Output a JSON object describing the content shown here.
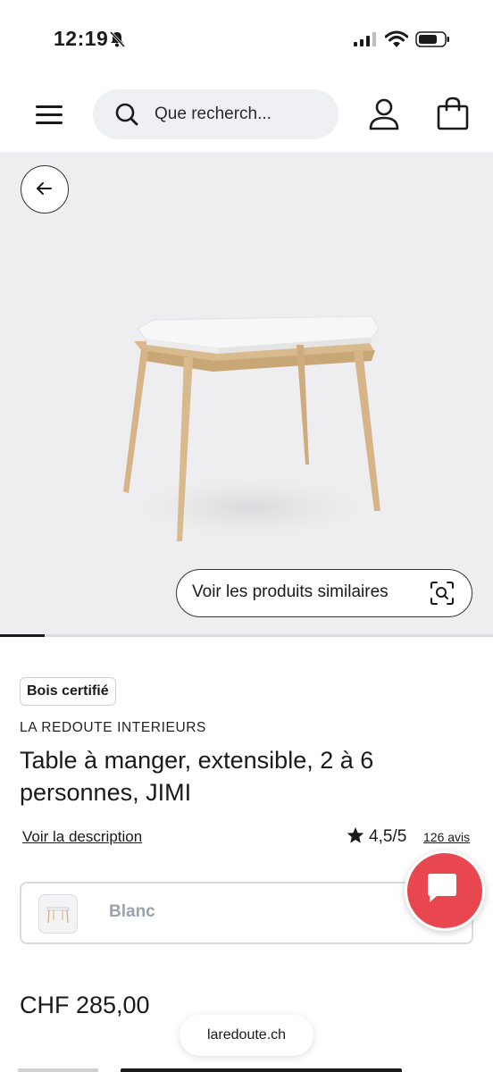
{
  "status_bar": {
    "time": "12:19"
  },
  "header": {
    "search_placeholder": "Que recherch...",
    "menu_icon": "hamburger-menu-icon",
    "account_icon": "user-icon",
    "cart_icon": "shopping-bag-icon"
  },
  "gallery": {
    "similar_label": "Voir les produits similaires",
    "progress": 0.09
  },
  "product": {
    "badge": "Bois certifié",
    "brand": "LA REDOUTE INTERIEURS",
    "title": "Table à manger, extensible, 2 à 6 personnes, JIMI",
    "description_link": "Voir la description",
    "rating": "4,5/5",
    "reviews": "126 avis",
    "color": "Blanc",
    "price": "CHF 285,00"
  },
  "browser": {
    "url": "laredoute.ch"
  },
  "colors": {
    "accent": "#e8474f",
    "search_bg": "#eef0f4",
    "hero_bg": "#eeeef0"
  }
}
